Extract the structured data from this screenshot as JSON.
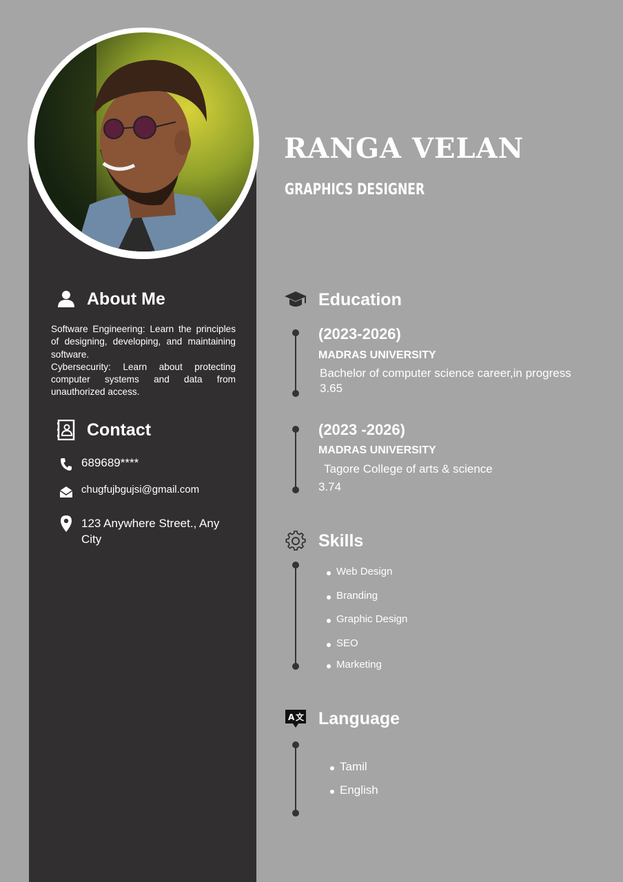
{
  "header": {
    "name": "RANGA VELAN",
    "title": "GRAPHICS DESIGNER"
  },
  "about": {
    "heading": "About Me",
    "paragraphs": [
      "Software Engineering: Learn the principles of designing, developing, and maintaining software.",
      "Cybersecurity: Learn about protecting computer systems and data from unauthorized access."
    ]
  },
  "contact": {
    "heading": "Contact",
    "phone": "689689****",
    "email": "chugfujbgujsi@gmail.com",
    "address": "123 Anywhere Street., Any City"
  },
  "education": {
    "heading": "Education",
    "entries": [
      {
        "years": "(2023-2026)",
        "university": "MADRAS UNIVERSITY",
        "detail": "Bachelor of computer science career,in progress",
        "score": "3.65"
      },
      {
        "years": "(2023 -2026)",
        "university": "MADRAS UNIVERSITY",
        "detail": "Tagore College of arts & science",
        "score": "3.74"
      }
    ]
  },
  "skills": {
    "heading": "Skills",
    "items": [
      "Web Design",
      "Branding",
      "Graphic Design",
      "SEO",
      "Marketing"
    ]
  },
  "language": {
    "heading": "Language",
    "items": [
      "Tamil",
      "English"
    ]
  },
  "icons": {
    "about": "person-icon",
    "contact": "contact-book-icon",
    "phone": "phone-icon",
    "email": "envelope-icon",
    "address": "location-pin-icon",
    "education": "graduation-cap-icon",
    "skills": "gear-icon",
    "language": "translate-icon"
  },
  "colors": {
    "background": "#a5a5a5",
    "sidebar": "#312f30",
    "text": "#ffffff",
    "timeline": "#333333"
  }
}
